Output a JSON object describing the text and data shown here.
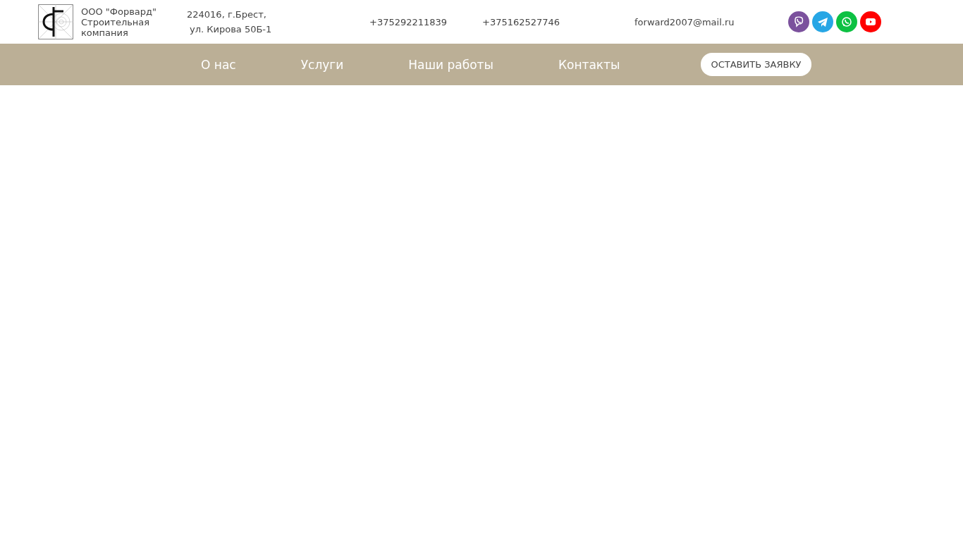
{
  "header": {
    "company": [
      "ООО \"Форвард\"",
      "Строительная",
      "компания"
    ],
    "address": [
      "224016, г.Брест,",
      "ул. Кирова 50Б-1"
    ],
    "phones": [
      "+375292211839",
      "+375162527746"
    ],
    "email": "forward2007@mail.ru",
    "social": [
      {
        "kind": "viber",
        "color": "#7b519d"
      },
      {
        "kind": "telegram",
        "color": "#27a6e5"
      },
      {
        "kind": "whatsapp",
        "color": "#0dc143"
      },
      {
        "kind": "youtube",
        "color": "#ff0000"
      }
    ]
  },
  "nav": {
    "items": [
      "О нас",
      "Услуги",
      "Наши работы",
      "Контакты"
    ],
    "button": "ОСТАВИТЬ ЗАЯВКУ"
  }
}
